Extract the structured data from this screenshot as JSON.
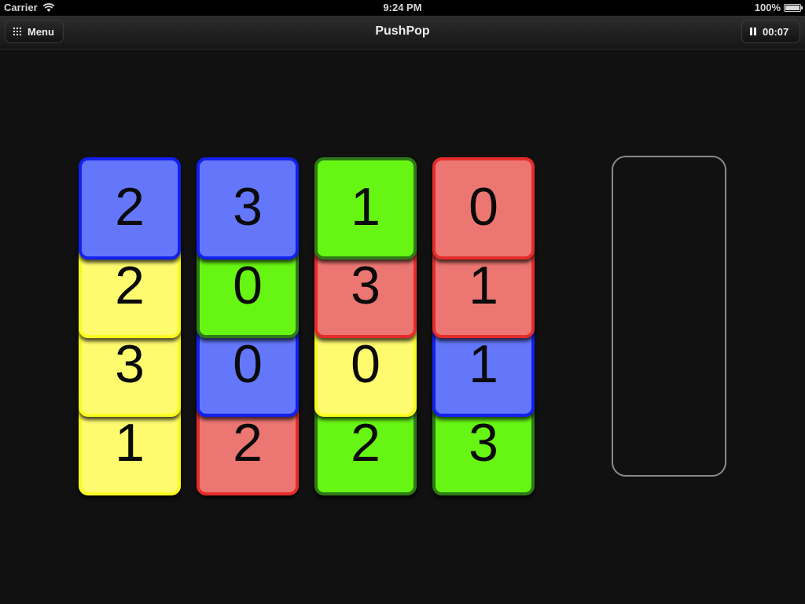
{
  "status_bar": {
    "carrier": "Carrier",
    "time": "9:24 PM",
    "battery": "100%"
  },
  "nav": {
    "title": "PushPop",
    "menu_label": "Menu",
    "timer": "00:07"
  },
  "colors": {
    "yellow": "#fefb6e",
    "blue": "#6477fb",
    "green": "#67f513",
    "red": "#ec7671"
  },
  "columns": [
    {
      "tiles": [
        {
          "value": "1",
          "color": "yellow"
        },
        {
          "value": "3",
          "color": "yellow"
        },
        {
          "value": "2",
          "color": "yellow"
        },
        {
          "value": "2",
          "color": "blue"
        }
      ]
    },
    {
      "tiles": [
        {
          "value": "2",
          "color": "red"
        },
        {
          "value": "0",
          "color": "blue"
        },
        {
          "value": "0",
          "color": "green"
        },
        {
          "value": "3",
          "color": "blue"
        }
      ]
    },
    {
      "tiles": [
        {
          "value": "2",
          "color": "green"
        },
        {
          "value": "0",
          "color": "yellow"
        },
        {
          "value": "3",
          "color": "red"
        },
        {
          "value": "1",
          "color": "green"
        }
      ]
    },
    {
      "tiles": [
        {
          "value": "3",
          "color": "green"
        },
        {
          "value": "1",
          "color": "blue"
        },
        {
          "value": "1",
          "color": "red"
        },
        {
          "value": "0",
          "color": "red"
        }
      ]
    }
  ]
}
